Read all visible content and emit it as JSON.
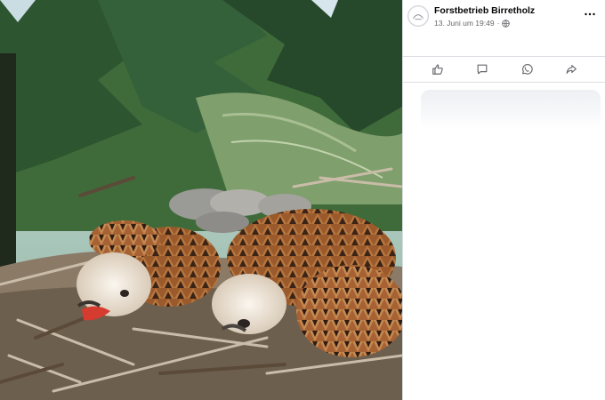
{
  "post": {
    "page_name": "Forstbetrieb Birretholz",
    "timestamp": "13. Juni um 19:49",
    "privacy_icon": "globe-icon",
    "menu_icon": "more-options-icon"
  },
  "actions": [
    {
      "name": "like",
      "icon": "thumbs-up-icon"
    },
    {
      "name": "comment",
      "icon": "comment-icon"
    },
    {
      "name": "whatsapp-share",
      "icon": "whatsapp-icon"
    },
    {
      "name": "share",
      "icon": "share-icon"
    }
  ],
  "colors": {
    "text_primary": "#050505",
    "text_secondary": "#65676b",
    "divider": "#dadde1",
    "icon": "#65676b"
  }
}
